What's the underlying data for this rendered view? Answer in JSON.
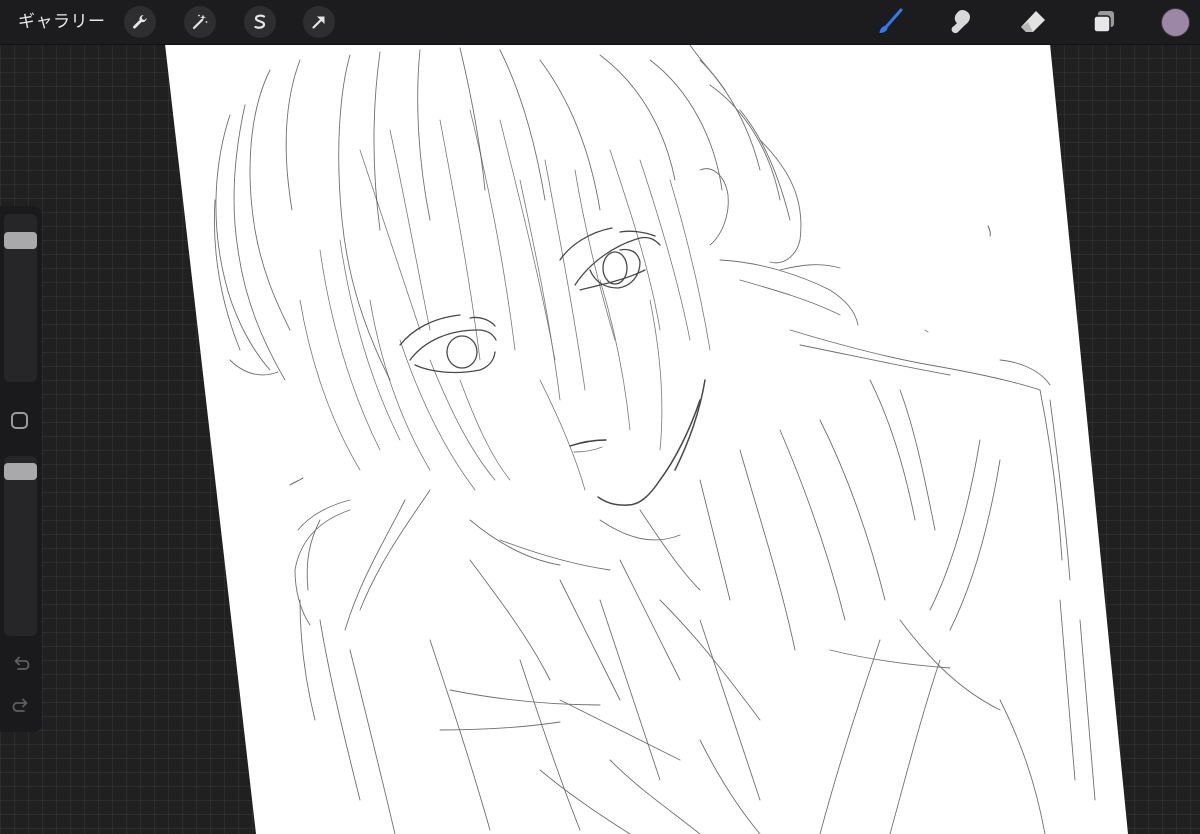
{
  "toolbar": {
    "gallery_label": "ギャラリー",
    "left_tools": [
      {
        "name": "actions",
        "icon": "wrench-icon"
      },
      {
        "name": "adjustments",
        "icon": "magic-wand-icon"
      },
      {
        "name": "selection",
        "icon": "selection-s-icon"
      },
      {
        "name": "transform",
        "icon": "arrow-cursor-icon"
      }
    ],
    "right_tools": [
      {
        "name": "brush",
        "icon": "brush-icon",
        "active": true
      },
      {
        "name": "smudge",
        "icon": "smudge-finger-icon",
        "active": false
      },
      {
        "name": "eraser",
        "icon": "eraser-icon",
        "active": false
      },
      {
        "name": "layers",
        "icon": "layers-icon",
        "active": false
      }
    ],
    "current_color": "#9c88a6",
    "active_color": "#2f7bf5"
  },
  "sidebar": {
    "brush_size_level": 0.12,
    "opacity_level": 0.04,
    "icons": [
      "modify-square-icon",
      "undo-arrow-icon",
      "redo-arrow-icon"
    ]
  },
  "colors": {
    "background": "#202020",
    "toolbar": "#1c1c1e",
    "canvas": "#ffffff",
    "sketch_line": "#3a3a3a"
  }
}
